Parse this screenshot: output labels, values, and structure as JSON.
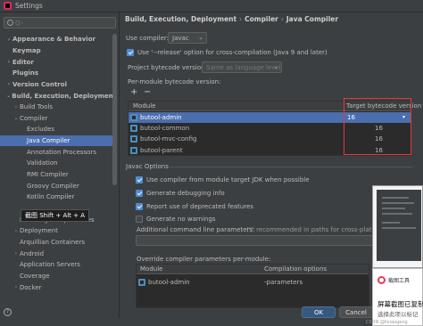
{
  "window": {
    "title": "Settings"
  },
  "sidebar": {
    "search_placeholder": "Q-",
    "items": [
      {
        "label": "Appearance & Behavior",
        "arrow": "›",
        "bold": true
      },
      {
        "label": "Keymap",
        "arrow": "",
        "bold": true
      },
      {
        "label": "Editor",
        "arrow": "›",
        "bold": true
      },
      {
        "label": "Plugins",
        "arrow": "",
        "bold": true
      },
      {
        "label": "Version Control",
        "arrow": "›",
        "bold": true
      },
      {
        "label": "Build, Execution, Deployment",
        "arrow": "⌄",
        "bold": true
      },
      {
        "label": "Build Tools",
        "arrow": "›"
      },
      {
        "label": "Compiler",
        "arrow": "⌄"
      },
      {
        "label": "Excludes",
        "arrow": ""
      },
      {
        "label": "Java Compiler",
        "arrow": "",
        "selected": true
      },
      {
        "label": "Annotation Processors",
        "arrow": ""
      },
      {
        "label": "Validation",
        "arrow": ""
      },
      {
        "label": "RMI Compiler",
        "arrow": ""
      },
      {
        "label": "Groovy Compiler",
        "arrow": ""
      },
      {
        "label": "Kotlin Compiler",
        "arrow": ""
      },
      {
        "label": "",
        "arrow": ""
      },
      {
        "label": "Remote Jar Repositories",
        "arrow": ""
      },
      {
        "label": "Deployment",
        "arrow": "›"
      },
      {
        "label": "Arquillian Containers",
        "arrow": ""
      },
      {
        "label": "Android",
        "arrow": "›"
      },
      {
        "label": "Application Servers",
        "arrow": ""
      },
      {
        "label": "Coverage",
        "arrow": ""
      },
      {
        "label": "Docker",
        "arrow": "›"
      }
    ],
    "tooltip": "截图 Shift + Alt + A"
  },
  "breadcrumb": [
    "Build, Execution, Deployment",
    "Compiler",
    "Java Compiler"
  ],
  "form": {
    "use_compiler_label": "Use compiler:",
    "use_compiler_value": "Javac",
    "release_option_label": "Use '--release' option for cross-compilation (Java 9 and later)",
    "project_bytecode_label": "Project bytecode version:",
    "project_bytecode_value": "Same as language level",
    "per_module_label": "Per-module bytecode version:",
    "add_button": "+",
    "remove_button": "−",
    "module_table": {
      "headers": [
        "Module",
        "Target bytecode version"
      ],
      "rows": [
        {
          "module": "butool-admin",
          "version": "16"
        },
        {
          "module": "butool-common",
          "version": "16"
        },
        {
          "module": "butool-mvc-config",
          "version": "16"
        },
        {
          "module": "butool-parent",
          "version": "16"
        }
      ]
    },
    "javac_options_title": "Javac Options",
    "checkboxes": [
      {
        "label": "Use compiler from module target JDK when possible",
        "checked": true
      },
      {
        "label": "Generate debugging info",
        "checked": true
      },
      {
        "label": "Report use of deprecated features",
        "checked": true
      },
      {
        "label": "Generate no warnings",
        "checked": false
      }
    ],
    "additional_params_label": "Additional command line parameters:",
    "additional_params_hint": "('/' recommended in paths for cross-platform co",
    "override_label": "Override compiler parameters per-module:",
    "override_table": {
      "headers": [
        "Module",
        "Compilation options"
      ],
      "rows": [
        {
          "module": "butool-admin",
          "options": "-parameters"
        }
      ]
    }
  },
  "buttons": {
    "ok": "OK",
    "cancel": "Cancel"
  },
  "overlay": {
    "app_name": "截图工具",
    "message": "屏幕截图已复制",
    "sub_message": "选择此项以标记"
  },
  "watermark": "CSDN @lixiaogeng"
}
